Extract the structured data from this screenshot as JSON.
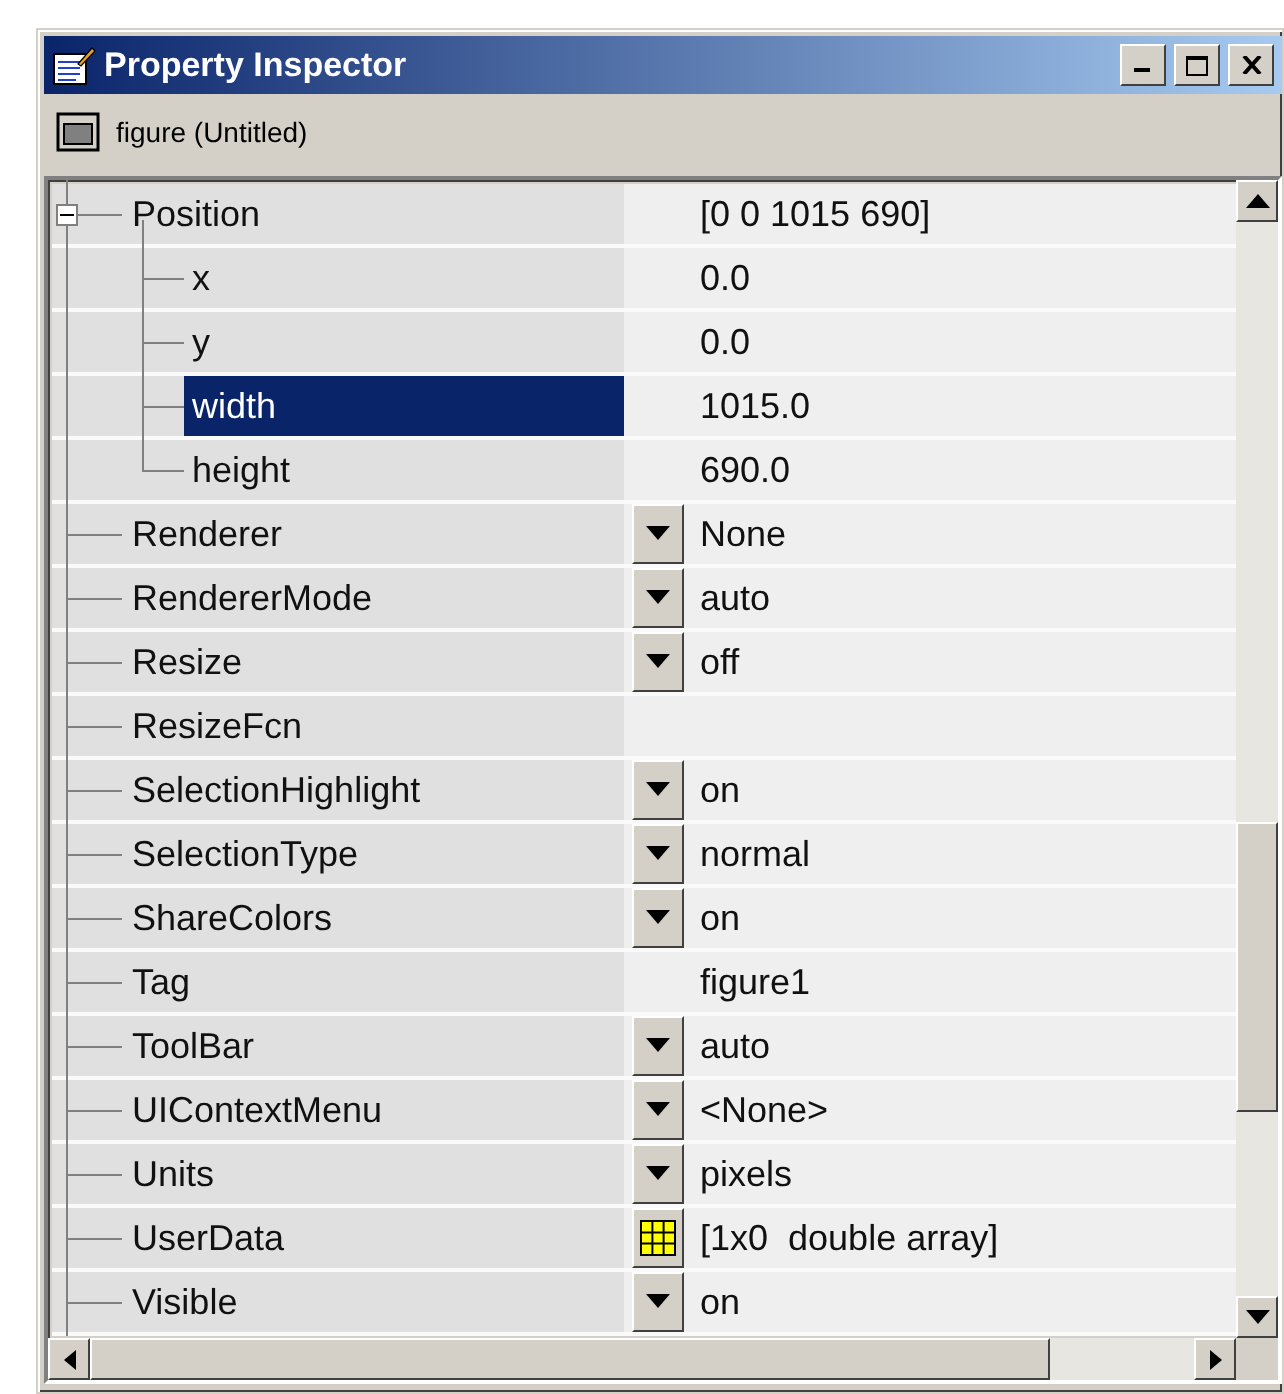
{
  "window": {
    "title": "Property Inspector"
  },
  "object": {
    "label": "figure (Untitled)"
  },
  "properties": [
    {
      "name": "Position",
      "value": "[0 0 1015 690]",
      "kind": "plain",
      "selected": false,
      "expanded": true,
      "children": [
        {
          "name": "x",
          "value": "0.0",
          "kind": "plain",
          "selected": false
        },
        {
          "name": "y",
          "value": "0.0",
          "kind": "plain",
          "selected": false
        },
        {
          "name": "width",
          "value": "1015.0",
          "kind": "plain",
          "selected": true
        },
        {
          "name": "height",
          "value": "690.0",
          "kind": "plain",
          "selected": false
        }
      ]
    },
    {
      "name": "Renderer",
      "value": "None",
      "kind": "dropdown",
      "selected": false
    },
    {
      "name": "RendererMode",
      "value": "auto",
      "kind": "dropdown",
      "selected": false
    },
    {
      "name": "Resize",
      "value": "off",
      "kind": "dropdown",
      "selected": false
    },
    {
      "name": "ResizeFcn",
      "kind": "plain",
      "selected": false
    },
    {
      "name": "SelectionHighlight",
      "value": "on",
      "kind": "dropdown",
      "selected": false
    },
    {
      "name": "SelectionType",
      "value": "normal",
      "kind": "dropdown",
      "selected": false
    },
    {
      "name": "ShareColors",
      "value": "on",
      "kind": "dropdown",
      "selected": false
    },
    {
      "name": "Tag",
      "value": "figure1",
      "kind": "plain",
      "selected": false
    },
    {
      "name": "ToolBar",
      "value": "auto",
      "kind": "dropdown",
      "selected": false
    },
    {
      "name": "UIContextMenu",
      "value": "<None>",
      "kind": "dropdown",
      "selected": false
    },
    {
      "name": "Units",
      "value": "pixels",
      "kind": "dropdown",
      "selected": false
    },
    {
      "name": "UserData",
      "value": "[1x0  double array]",
      "kind": "array",
      "selected": false
    },
    {
      "name": "Visible",
      "value": "on",
      "kind": "dropdown",
      "selected": false
    }
  ]
}
